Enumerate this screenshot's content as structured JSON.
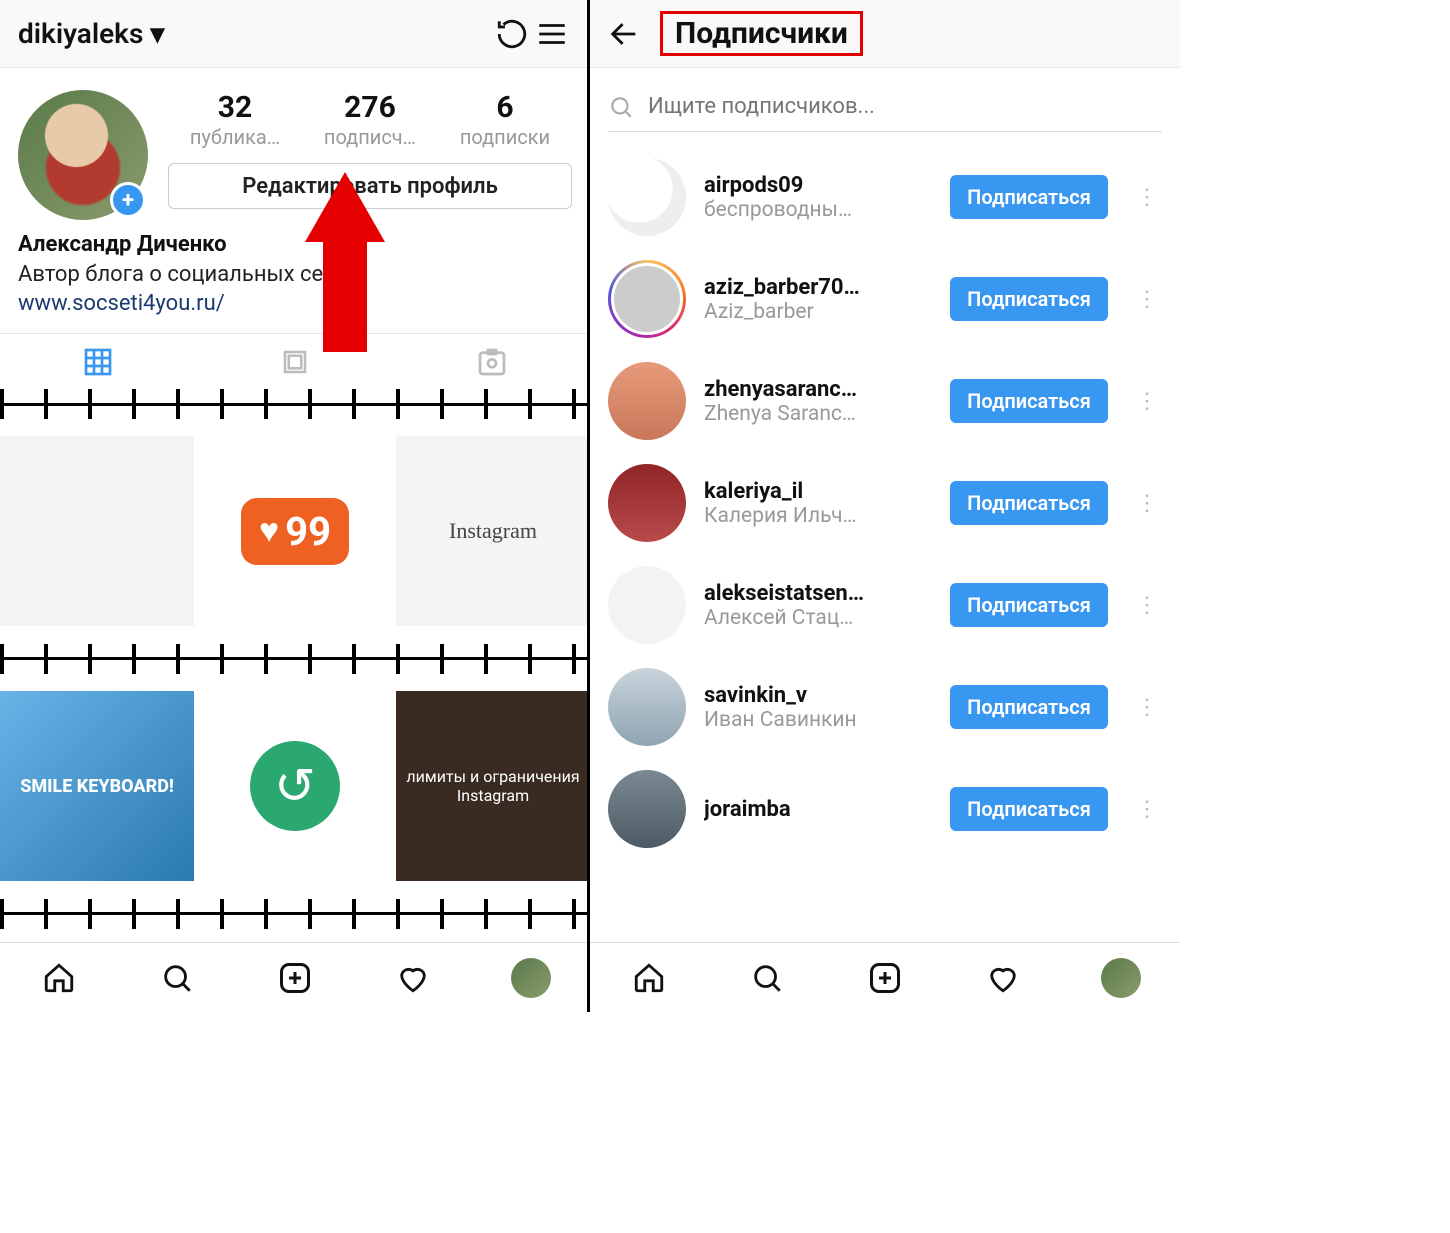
{
  "left": {
    "username": "dikiyaleks",
    "stats": {
      "posts": {
        "count": "32",
        "label": "публика…"
      },
      "followers": {
        "count": "276",
        "label": "подписч…"
      },
      "following": {
        "count": "6",
        "label": "подписки"
      }
    },
    "edit_label": "Редактировать профиль",
    "bio": {
      "name": "Александр Диченко",
      "desc": "Автор блога о социальных сетях",
      "link": "www.socseti4you.ru/"
    },
    "tiles": {
      "like_badge": "99",
      "ig_text": "Instagram",
      "smile_text": "SMILE KEYBOARD!",
      "limits_text": "лимиты и ограничения Instagram"
    }
  },
  "right": {
    "title": "Подписчики",
    "search_placeholder": "Ищите подписчиков...",
    "follow_label": "Подписаться",
    "followers": [
      {
        "username": "airpods09",
        "name": "беспроводны…",
        "avatar": "c1",
        "story": false
      },
      {
        "username": "aziz_barber70…",
        "name": "Aziz_barber",
        "avatar": "c2",
        "story": true
      },
      {
        "username": "zhenyasaranc…",
        "name": "Zhenya Saranc…",
        "avatar": "c3",
        "story": false
      },
      {
        "username": "kaleriya_il",
        "name": "Калерия Ильч…",
        "avatar": "c4",
        "story": false
      },
      {
        "username": "alekseistatsen…",
        "name": "Алексей Стац…",
        "avatar": "c5",
        "story": false
      },
      {
        "username": "savinkin_v",
        "name": "Иван Савинкин",
        "avatar": "c6",
        "story": false
      },
      {
        "username": "joraimba",
        "name": "",
        "avatar": "c7",
        "story": false
      }
    ]
  }
}
